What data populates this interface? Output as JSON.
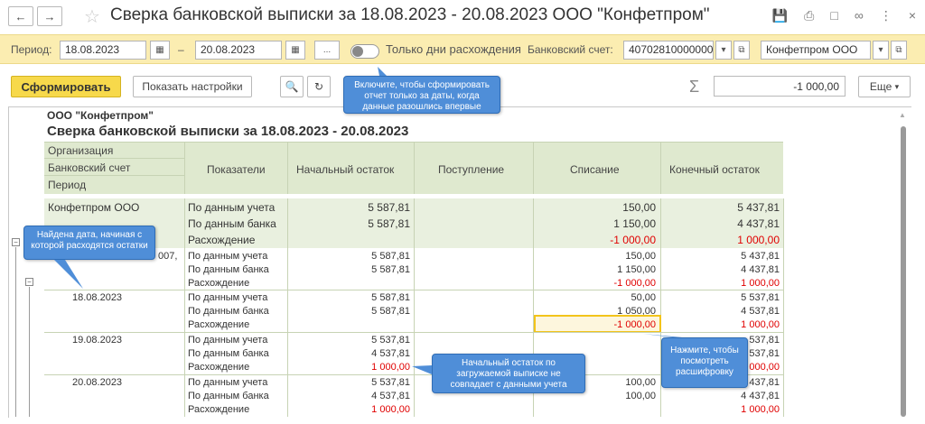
{
  "window": {
    "title": "Сверка банковской выписки за 18.08.2023 - 20.08.2023 ООО \"Конфетпром\""
  },
  "filters": {
    "period_label": "Период:",
    "date_from": "18.08.2023",
    "dash": "–",
    "date_to": "20.08.2023",
    "more_btn": "...",
    "only_diff_label": "Только дни расхождения",
    "bank_account_label": "Банковский счет:",
    "bank_account_value": "40702810000000",
    "org_value": "Конфетпром ООО"
  },
  "toolbar": {
    "generate": "Сформировать",
    "show_settings": "Показать настройки",
    "sum_value": "-1 000,00",
    "more": "Еще"
  },
  "report": {
    "org": "ООО \"Конфетпром\"",
    "title": "Сверка банковской выписки  за 18.08.2023 - 20.08.2023",
    "head": {
      "organization": "Организация",
      "bank_account": "Банковский счет",
      "period": "Период",
      "indicators": "Показатели",
      "opening": "Начальный остаток",
      "receipts": "Поступление",
      "writeoff": "Списание",
      "closing": "Конечный остаток"
    },
    "group": {
      "label": "Конфетпром ООО",
      "rows": [
        {
          "ind": "По данным учета",
          "open": "5 587,81",
          "wo": "150,00",
          "close": "5 437,81"
        },
        {
          "ind": "По данным банка",
          "open": "5 587,81",
          "wo": "1 150,00",
          "close": "4 437,81"
        },
        {
          "ind": "Расхождение",
          "open": "",
          "wo": "-1 000,00",
          "close": "1 000,00"
        }
      ]
    },
    "account": {
      "label_tail": "007,",
      "rows": [
        {
          "ind": "По данным учета",
          "open": "5 587,81",
          "wo": "150,00",
          "close": "5 437,81"
        },
        {
          "ind": "По данным банка",
          "open": "5 587,81",
          "wo": "1 150,00",
          "close": "4 437,81"
        },
        {
          "ind": "Расхождение",
          "open": "",
          "wo": "-1 000,00",
          "close": "1 000,00"
        }
      ]
    },
    "days": [
      {
        "date": "18.08.2023",
        "rows": [
          {
            "ind": "По данным учета",
            "open": "5 587,81",
            "wo": "50,00",
            "close": "5 537,81"
          },
          {
            "ind": "По данным банка",
            "open": "5 587,81",
            "wo": "1 050,00",
            "close": "4 537,81"
          },
          {
            "ind": "Расхождение",
            "open": "",
            "wo": "-1 000,00",
            "close": "1 000,00"
          }
        ]
      },
      {
        "date": "19.08.2023",
        "rows": [
          {
            "ind": "По данным учета",
            "open": "5 537,81",
            "wo": "",
            "close": "537,81"
          },
          {
            "ind": "По данным банка",
            "open": "4 537,81",
            "wo": "",
            "close": "537,81"
          },
          {
            "ind": "Расхождение",
            "open": "1 000,00",
            "wo": "",
            "close": "000,00"
          }
        ]
      },
      {
        "date": "20.08.2023",
        "rows": [
          {
            "ind": "По данным учета",
            "open": "5 537,81",
            "wo": "100,00",
            "close": "437,81"
          },
          {
            "ind": "По данным банка",
            "open": "4 537,81",
            "wo": "100,00",
            "close": "4 437,81"
          },
          {
            "ind": "Расхождение",
            "open": "1 000,00",
            "wo": "",
            "close": "1 000,00"
          }
        ]
      }
    ]
  },
  "callouts": {
    "toggle_hint": "Включите, чтобы сформировать отчет только за даты, когда данные разошлись впервые",
    "date_found": "Найдена дата, начиная с которой расходятся остатки",
    "opening_mismatch": "Начальный остаток по загружаемой выписке не совпадает с данными учета",
    "click_detail": "Нажмите, чтобы посмотреть расшифровку"
  },
  "colors": {
    "filter_bg": "#fbedb1",
    "primary_btn": "#f7d94b",
    "header_bg": "#dfe9cf",
    "negative": "#e00000",
    "callout": "#4f8ed8",
    "highlight": "#f3c41a"
  }
}
